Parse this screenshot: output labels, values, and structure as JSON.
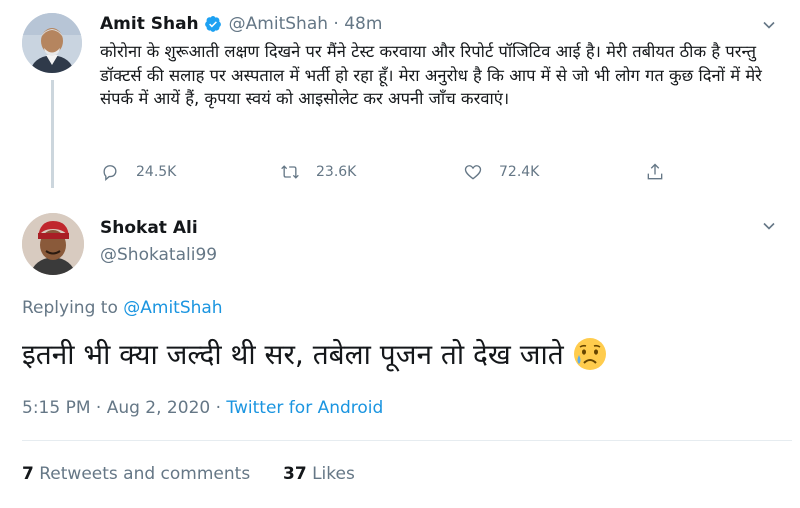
{
  "parent_tweet": {
    "author_name": "Amit Shah",
    "handle": "@AmitShah",
    "time": "· 48m",
    "text": "कोरोना के शुरूआती लक्षण दिखने पर मैंने टेस्ट करवाया और रिपोर्ट पॉजिटिव आई है। मेरी तबीयत ठीक है परन्तु डॉक्टर्स की सलाह पर अस्पताल में भर्ती हो रहा हूँ। मेरा अनुरोध है कि आप में से जो भी लोग गत कुछ दिनों में मेरे संपर्क में आयें हैं, कृपया स्वयं को आइसोलेट कर अपनी जाँच करवाएं।",
    "replies": "24.5K",
    "retweets": "23.6K",
    "likes": "72.4K"
  },
  "reply_tweet": {
    "author_name": "Shokat Ali",
    "handle": "@Shokatali99",
    "replying_prefix": "Replying to",
    "replying_to": "@AmitShah",
    "text": "इतनी भी क्या जल्दी थी सर, तबेला पूजन तो देख जाते",
    "time": "5:15 PM · Aug 2, 2020 ·",
    "source": "Twitter for Android",
    "retweets_count": "7",
    "retweets_label": "Retweets and comments",
    "likes_count": "37",
    "likes_label": "Likes"
  },
  "colors": {
    "accent": "#1b95e0",
    "muted": "#657786",
    "text": "#14171a"
  },
  "icons": [
    "verified-badge-icon",
    "chevron-down-icon",
    "reply-icon",
    "retweet-icon",
    "like-icon",
    "share-icon",
    "sad-sweat-emoji"
  ]
}
